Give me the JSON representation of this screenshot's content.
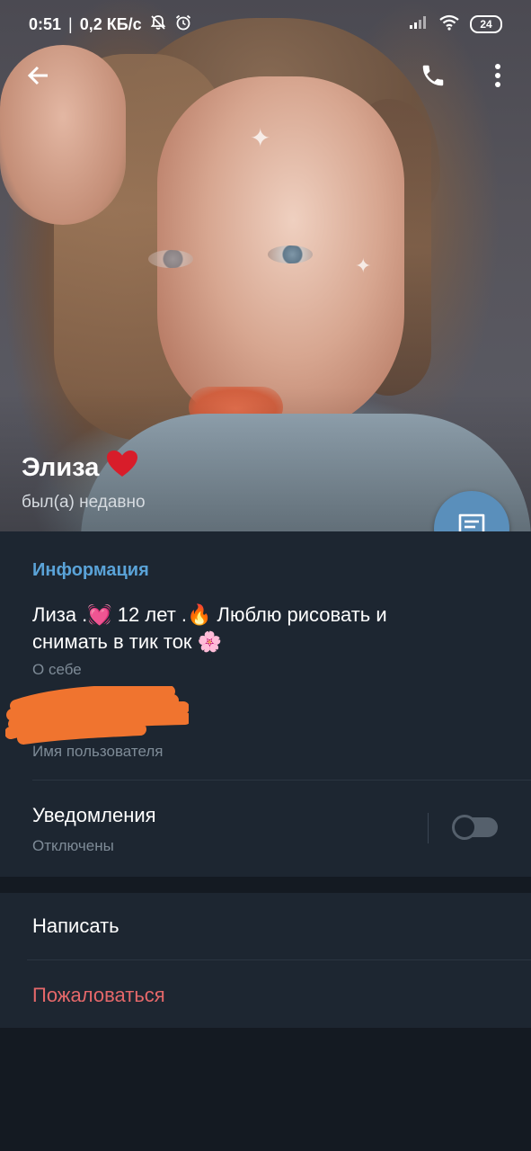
{
  "status_bar": {
    "time": "0:51",
    "separator": "|",
    "speed": "0,2 КБ/с",
    "battery": "24"
  },
  "header": {
    "name": "Элиза",
    "status": "был(а) недавно"
  },
  "info": {
    "section_title": "Информация",
    "bio_line1": "Лиза .💓 12 лет .🔥 Люблю рисовать и",
    "bio_line2": "снимать в тик ток 🌸",
    "bio_label": "О себе",
    "username_value": "",
    "username_label": "Имя пользователя",
    "notifications_label": "Уведомления",
    "notifications_status": "Отключены",
    "notifications_enabled": false
  },
  "actions": {
    "write": "Написать",
    "report": "Пожаловаться"
  },
  "colors": {
    "accent": "#5aa3d8",
    "fab": "#5a8fbb",
    "danger": "#e5686a",
    "panel": "#1d2631",
    "background": "#141a22",
    "redaction": "#f0742f"
  },
  "icons": {
    "back": "back-arrow-icon",
    "call": "phone-icon",
    "menu": "more-vertical-icon",
    "fab": "message-icon",
    "name_badge": "heart-icon"
  }
}
